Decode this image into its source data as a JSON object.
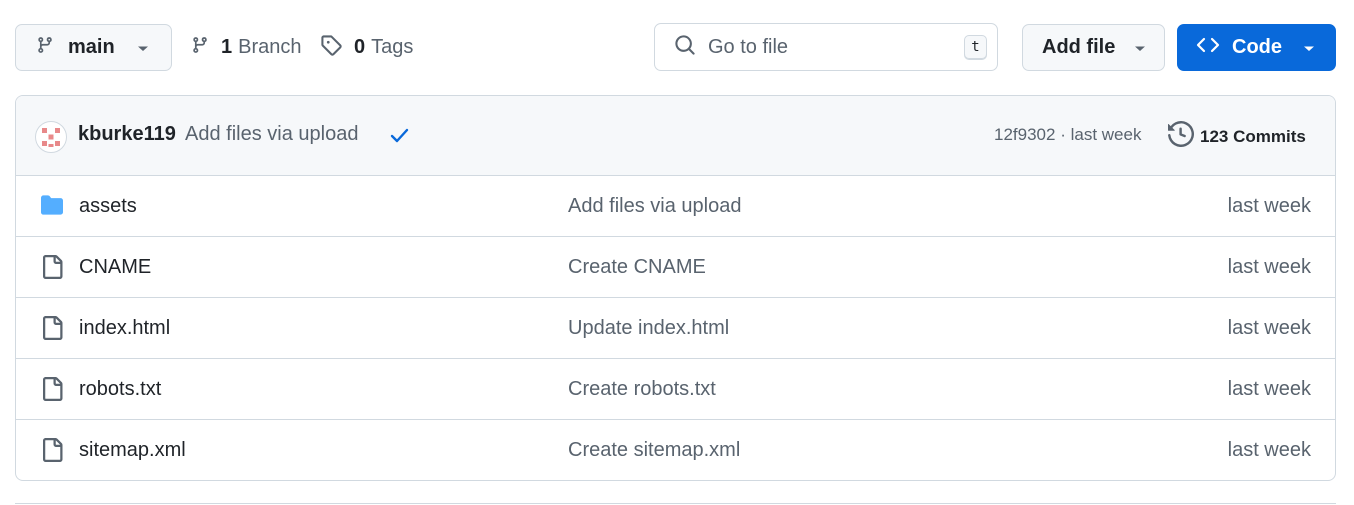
{
  "toolbar": {
    "branch_name": "main",
    "branches_count": "1",
    "branches_label": "Branch",
    "tags_count": "0",
    "tags_label": "Tags",
    "search_placeholder": "Go to file",
    "search_shortcut": "t",
    "add_file_label": "Add file",
    "code_label": "Code"
  },
  "commit": {
    "author": "kburke119",
    "message": "Add files via upload",
    "hash": "12f9302",
    "separator": "·",
    "time": "last week",
    "commits_count_label": "123 Commits"
  },
  "files": [
    {
      "name": "assets",
      "type": "folder",
      "message": "Add files via upload",
      "time": "last week"
    },
    {
      "name": "CNAME",
      "type": "file",
      "message": "Create CNAME",
      "time": "last week"
    },
    {
      "name": "index.html",
      "type": "file",
      "message": "Update index.html",
      "time": "last week"
    },
    {
      "name": "robots.txt",
      "type": "file",
      "message": "Create robots.txt",
      "time": "last week"
    },
    {
      "name": "sitemap.xml",
      "type": "file",
      "message": "Create sitemap.xml",
      "time": "last week"
    }
  ],
  "colors": {
    "primary_button": "#0969da",
    "folder_icon": "#54aeff",
    "check_icon": "#0969da",
    "border": "#d1d9e0"
  }
}
